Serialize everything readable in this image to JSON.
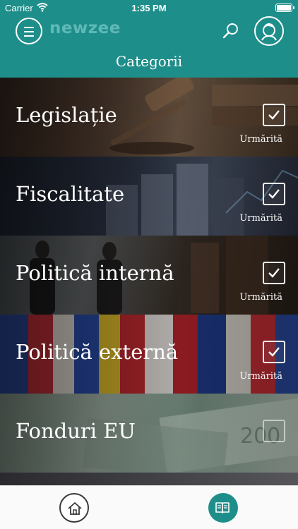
{
  "status_bar": {
    "carrier": "Carrier",
    "time": "1:35 PM"
  },
  "header": {
    "app_name": "newzee",
    "page_title": "Categorii",
    "background_color": "#1e8e8a",
    "icons": [
      "hamburger-menu-icon",
      "search-icon",
      "user-avatar-icon"
    ]
  },
  "categories": [
    {
      "name": "Legislație",
      "followed": true,
      "followed_label": "Urmărită",
      "image": "judge-gavel"
    },
    {
      "name": "Fiscalitate",
      "followed": true,
      "followed_label": "Urmărită",
      "image": "coin-stacks"
    },
    {
      "name": "Politică internă",
      "followed": true,
      "followed_label": "Urmărită",
      "image": "people-meeting"
    },
    {
      "name": "Politică externă",
      "followed": true,
      "followed_label": "Urmărită",
      "image": "national-flags"
    },
    {
      "name": "Fonduri EU",
      "followed": false,
      "followed_label": "",
      "image": "euro-banknotes"
    }
  ],
  "tab_bar": {
    "tabs": [
      {
        "id": "home",
        "icon": "home-icon",
        "active": false
      },
      {
        "id": "categories",
        "icon": "book-icon",
        "active": true
      }
    ]
  }
}
